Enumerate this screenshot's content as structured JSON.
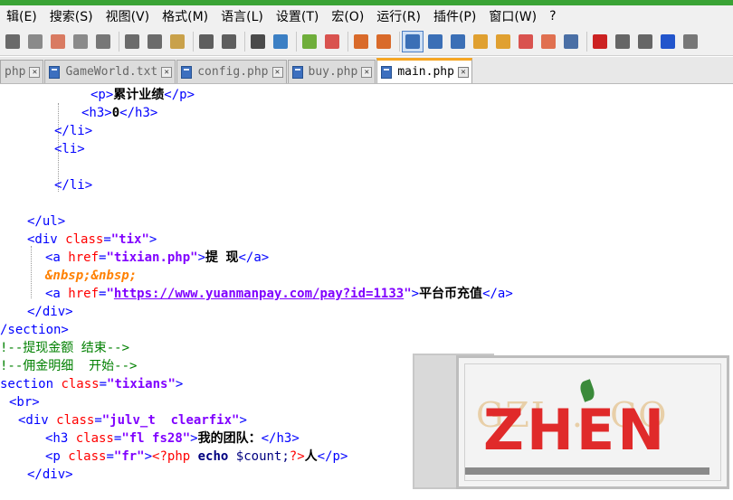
{
  "menu": [
    "辑(E)",
    "搜索(S)",
    "视图(V)",
    "格式(M)",
    "语言(L)",
    "设置(T)",
    "宏(O)",
    "运行(R)",
    "插件(P)",
    "窗口(W)",
    "?"
  ],
  "toolbar_icons": [
    {
      "name": "new-file-icon",
      "color": "#6a6a6a"
    },
    {
      "name": "open-file-icon",
      "color": "#8a8a8a"
    },
    {
      "name": "save-icon",
      "color": "#d97b62"
    },
    {
      "name": "save-all-icon",
      "color": "#8a8a8a"
    },
    {
      "name": "print-icon",
      "color": "#777777"
    },
    {
      "name": "cut-icon",
      "color": "#6b6b6b"
    },
    {
      "name": "copy-icon",
      "color": "#6b6b6b"
    },
    {
      "name": "paste-icon",
      "color": "#c9a14a"
    },
    {
      "name": "undo-icon",
      "color": "#5e5e5e"
    },
    {
      "name": "redo-icon",
      "color": "#5e5e5e"
    },
    {
      "name": "find-icon",
      "color": "#4a4a4a"
    },
    {
      "name": "replace-icon",
      "color": "#3b7fc4"
    },
    {
      "name": "zoom-in-icon",
      "color": "#6fae3b"
    },
    {
      "name": "zoom-out-icon",
      "color": "#d9534f"
    },
    {
      "name": "sync-vertical-icon",
      "color": "#d96a2a"
    },
    {
      "name": "sync-horizontal-icon",
      "color": "#d96a2a"
    },
    {
      "name": "word-wrap-icon",
      "color": "#3b6fb6"
    },
    {
      "name": "show-all-chars-icon",
      "color": "#3b6fb6"
    },
    {
      "name": "indent-guide-icon",
      "color": "#3b6fb6"
    },
    {
      "name": "user-language-icon",
      "color": "#e0a030"
    },
    {
      "name": "doc-map-icon",
      "color": "#e0a030"
    },
    {
      "name": "function-list-icon",
      "color": "#d9534f"
    },
    {
      "name": "folder-workspace-icon",
      "color": "#e07050"
    },
    {
      "name": "monitoring-icon",
      "color": "#4a6fa5"
    },
    {
      "name": "record-macro-icon",
      "color": "#cc2222"
    },
    {
      "name": "stop-record-icon",
      "color": "#666666"
    },
    {
      "name": "playback-macro-icon",
      "color": "#666666"
    },
    {
      "name": "run-macro-multiple-icon",
      "color": "#2255cc"
    },
    {
      "name": "save-macro-icon",
      "color": "#777777"
    }
  ],
  "tabs": [
    {
      "label": "php",
      "active": false
    },
    {
      "label": "GameWorld.txt",
      "active": false
    },
    {
      "label": "config.php",
      "active": false
    },
    {
      "label": "buy.php",
      "active": false
    },
    {
      "label": "main.php",
      "active": true
    }
  ],
  "code_lines": [
    {
      "indent": 100,
      "parts": [
        [
          "tag",
          "<p>"
        ],
        [
          "txt",
          "累计业绩"
        ],
        [
          "tag",
          "</p>"
        ]
      ]
    },
    {
      "indent": 90,
      "parts": [
        [
          "tag",
          "<h3>"
        ],
        [
          "txt",
          "0"
        ],
        [
          "tag",
          "</h3>"
        ]
      ]
    },
    {
      "indent": 60,
      "parts": [
        [
          "tag",
          "</li>"
        ]
      ]
    },
    {
      "indent": 60,
      "parts": [
        [
          "tag",
          "<li>"
        ]
      ]
    },
    {
      "indent": 60,
      "parts": []
    },
    {
      "indent": 60,
      "parts": [
        [
          "tag",
          "</li>"
        ]
      ]
    },
    {
      "indent": 30,
      "parts": []
    },
    {
      "indent": 30,
      "parts": [
        [
          "tag",
          "</ul>"
        ]
      ]
    },
    {
      "indent": 30,
      "parts": [
        [
          "tag",
          "<div "
        ],
        [
          "attr",
          "class"
        ],
        [
          "tag",
          "="
        ],
        [
          "val",
          "\"tix\""
        ],
        [
          "tag",
          ">"
        ]
      ]
    },
    {
      "indent": 50,
      "parts": [
        [
          "tag",
          "<a "
        ],
        [
          "attr",
          "href"
        ],
        [
          "tag",
          "="
        ],
        [
          "val",
          "\"tixian.php\""
        ],
        [
          "tag",
          ">"
        ],
        [
          "txt",
          "提 现"
        ],
        [
          "tag",
          "</a>"
        ]
      ]
    },
    {
      "indent": 50,
      "parts": [
        [
          "ent",
          "&nbsp;&nbsp;"
        ]
      ]
    },
    {
      "indent": 50,
      "parts": [
        [
          "tag",
          "<a "
        ],
        [
          "attr",
          "href"
        ],
        [
          "tag",
          "="
        ],
        [
          "val",
          "\""
        ],
        [
          "url",
          "https://www.yuanmanpay.com/pay?id=1133"
        ],
        [
          "val",
          "\""
        ],
        [
          "tag",
          ">"
        ],
        [
          "txt",
          "平台币充值"
        ],
        [
          "tag",
          "</a>"
        ]
      ]
    },
    {
      "indent": 30,
      "parts": [
        [
          "tag",
          "</div>"
        ]
      ]
    },
    {
      "indent": 0,
      "parts": [
        [
          "tag",
          "/section>"
        ]
      ]
    },
    {
      "indent": 0,
      "parts": [
        [
          "cmt",
          "!--提现金额 结束-->"
        ]
      ]
    },
    {
      "indent": 0,
      "parts": [
        [
          "cmt",
          "!--佣金明细  开始-->"
        ]
      ]
    },
    {
      "indent": 0,
      "parts": [
        [
          "tag",
          "section "
        ],
        [
          "attr",
          "class"
        ],
        [
          "tag",
          "="
        ],
        [
          "val",
          "\"tixians\""
        ],
        [
          "tag",
          ">"
        ]
      ]
    },
    {
      "indent": 10,
      "parts": [
        [
          "tag",
          "<br>"
        ]
      ]
    },
    {
      "indent": 20,
      "parts": [
        [
          "tag",
          "<div "
        ],
        [
          "attr",
          "class"
        ],
        [
          "tag",
          "="
        ],
        [
          "val",
          "\"julv_t  clearfix\""
        ],
        [
          "tag",
          ">"
        ]
      ]
    },
    {
      "indent": 50,
      "parts": [
        [
          "tag",
          "<h3 "
        ],
        [
          "attr",
          "class"
        ],
        [
          "tag",
          "="
        ],
        [
          "val",
          "\"fl fs28\""
        ],
        [
          "tag",
          ">"
        ],
        [
          "txt",
          "我的团队："
        ],
        [
          "tag",
          "</h3>"
        ]
      ]
    },
    {
      "indent": 50,
      "parts": [
        [
          "tag",
          "<p "
        ],
        [
          "attr",
          "class"
        ],
        [
          "tag",
          "="
        ],
        [
          "val",
          "\"fr\""
        ],
        [
          "tag",
          ">"
        ],
        [
          "php",
          "<?php "
        ],
        [
          "kw",
          "echo "
        ],
        [
          "var",
          "$count;"
        ],
        [
          "php",
          "?>"
        ],
        [
          "txt",
          "人"
        ],
        [
          "tag",
          "</p>"
        ]
      ]
    },
    {
      "indent": 30,
      "parts": [
        [
          "tag",
          "</div>"
        ]
      ]
    }
  ],
  "watermark": {
    "text": "ZHEN",
    "faint_text": "GZI ... CO",
    "color": "#e02a2a"
  }
}
